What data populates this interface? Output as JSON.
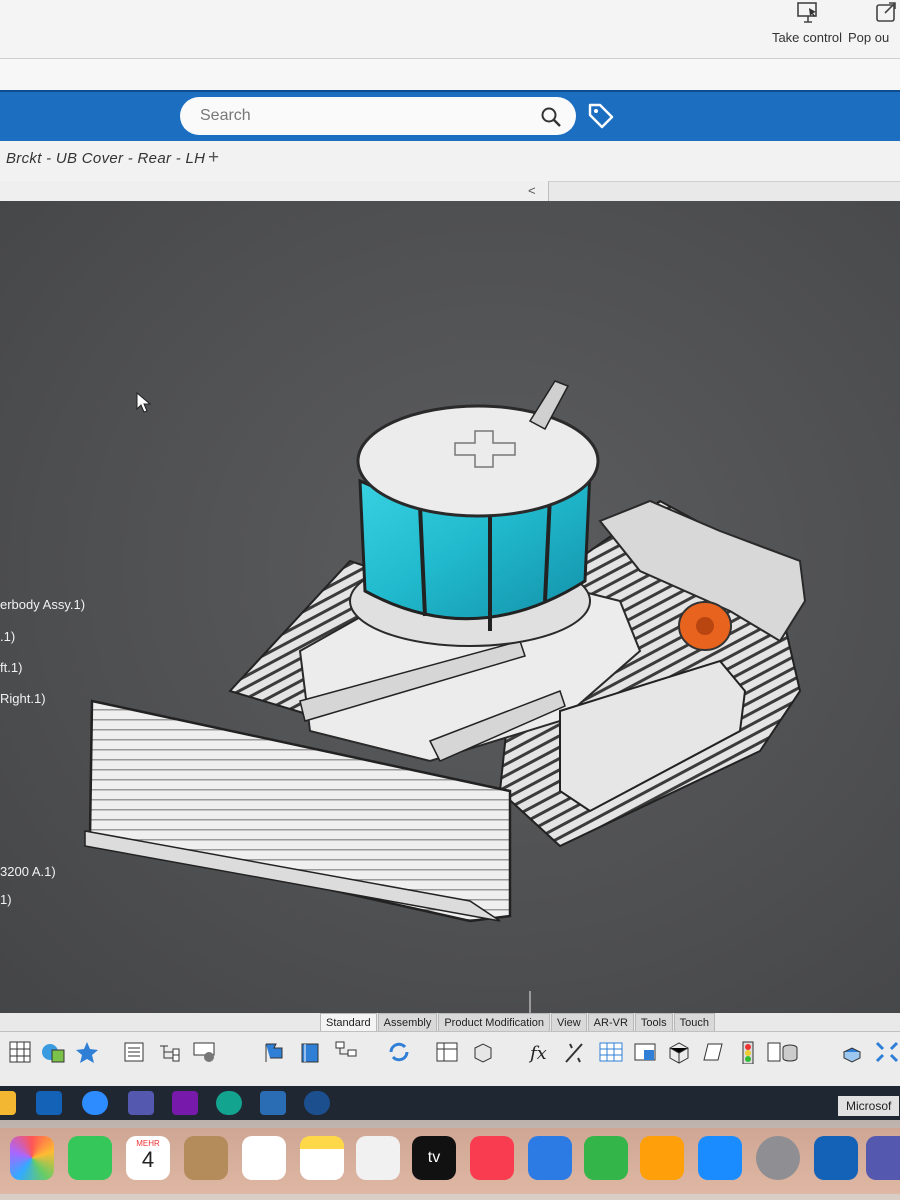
{
  "meeting_bar": {
    "take_control_label": "Take control",
    "pop_out_label": "Pop ou"
  },
  "search": {
    "placeholder": "Search"
  },
  "document_tab": {
    "title": "Brckt - UB Cover - Rear - LH",
    "add_label": "+"
  },
  "tree_panel": {
    "collapse_label": "<",
    "visible_items": [
      "erbody Assy.1)",
      ".1)",
      "ft.1)",
      "Right.1)",
      "3200 A.1)",
      "1)"
    ]
  },
  "toolbar_tabs": [
    "Standard",
    "Assembly",
    "Product Modification",
    "View",
    "AR-VR",
    "Tools",
    "Touch"
  ],
  "active_toolbar_tab": "Standard",
  "taskbar": {
    "apps": [
      "files-icon",
      "outlook-icon",
      "zoom-icon",
      "teams-icon",
      "onenote-icon",
      "edge-icon",
      "app-icon",
      "catia-icon"
    ],
    "label": "Microsof"
  },
  "dock": {
    "calendar_month": "MEHR",
    "calendar_day": "4",
    "tv_label": "tv"
  },
  "colors": {
    "accent_blue": "#1c6fc0",
    "viewport_bg": "#4e4f51",
    "cab_glass": "#2cc6d8",
    "highlight_orange": "#e8641e"
  }
}
